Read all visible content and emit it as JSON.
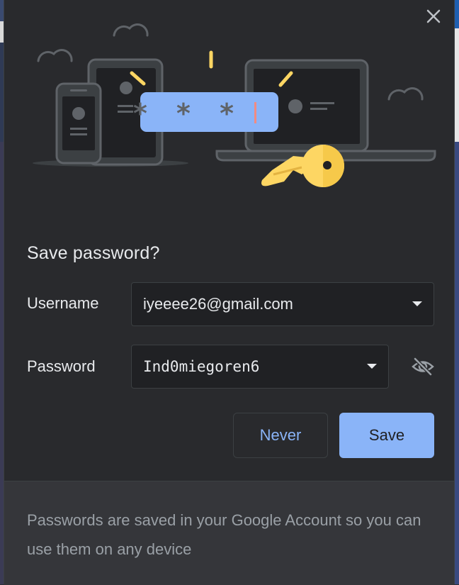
{
  "dialog": {
    "title": "Save password?",
    "username_label": "Username",
    "username_value": "iyeeee26@gmail.com",
    "password_label": "Password",
    "password_value": "Ind0miegoren6",
    "password_mask": "* * *",
    "never_label": "Never",
    "save_label": "Save",
    "footer_text": "Passwords are saved in your Google Account so you can use them on any device"
  },
  "icons": {
    "close": "close-icon",
    "dropdown": "chevron-down-icon",
    "visibility": "eye-off-icon",
    "key": "key-icon"
  },
  "colors": {
    "background": "#292a2d",
    "footer_background": "#35363a",
    "accent": "#8ab4f8",
    "key": "#fdd663",
    "text_primary": "#e8eaed",
    "text_secondary": "#9aa0a6"
  }
}
